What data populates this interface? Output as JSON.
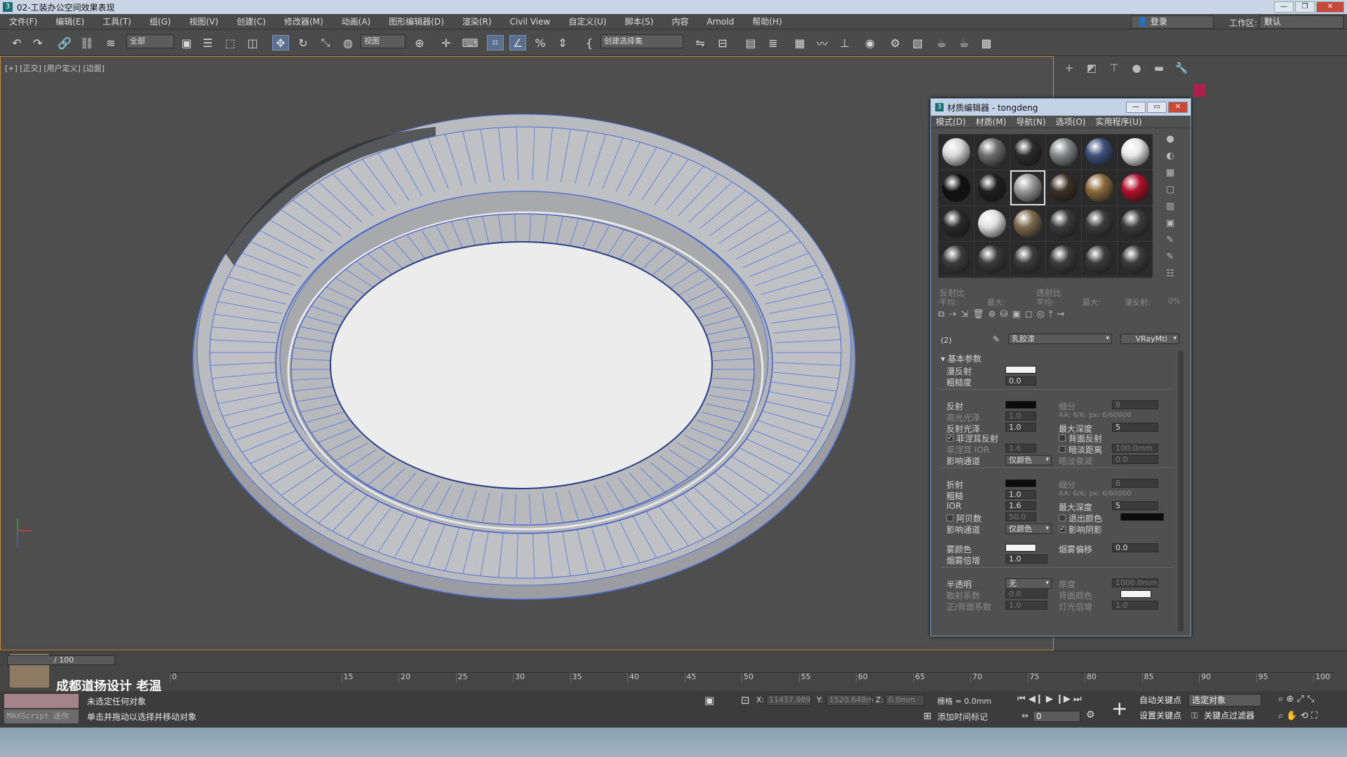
{
  "window": {
    "title": "02-工装办公空间效果表现"
  },
  "menu": [
    "文件(F)",
    "编辑(E)",
    "工具(T)",
    "组(G)",
    "视图(V)",
    "创建(C)",
    "修改器(M)",
    "动画(A)",
    "图形编辑器(D)",
    "渲染(R)",
    "Civil View",
    "自定义(U)",
    "脚本(S)",
    "内容",
    "Arnold",
    "帮助(H)"
  ],
  "account": {
    "login": "登录",
    "workspace_label": "工作区:",
    "workspace_value": "默认"
  },
  "toolbar": {
    "filter": "全部",
    "ref_coord": "视图",
    "selection_set": "创建选择集"
  },
  "viewport": {
    "label": "[+] [正交] [用户定义] [边面]"
  },
  "material_editor": {
    "title": "材质编辑器 - tongdeng",
    "menu": [
      "模式(D)",
      "材质(M)",
      "导航(N)",
      "选项(O)",
      "实用程序(U)"
    ],
    "slot_colors": [
      [
        "#d8d8d8",
        "#6e6e6e",
        "#2a2a2a",
        "#7f8a88",
        "#3c4f7a",
        "#e8e8e8"
      ],
      [
        "#111111",
        "#1e1e1e",
        "#9a9a9a",
        "#3b3026",
        "#8a6a3c",
        "#b0102a"
      ],
      [
        "#2a2a2a",
        "#e0e0e0",
        "#7d6a4e",
        "#3c3c3c",
        "#3c3c3c",
        "#3c3c3c"
      ],
      [
        "#3c3c3c",
        "#3c3c3c",
        "#3c3c3c",
        "#3c3c3c",
        "#3c3c3c",
        "#3c3c3c"
      ]
    ],
    "stats": {
      "reflect": "反射比",
      "trans": "透射比",
      "avg1": "平均:",
      "max1": "最大:",
      "avg2": "平均:",
      "max2": "最大:",
      "diffuse": "漫反射:",
      "pct": "0%"
    },
    "material_name": "乳胶漆",
    "material_type": "VRayMtl",
    "slot_index": "(2)",
    "rollout": "基本参数",
    "params": {
      "diffuse": "漫反射",
      "roughness": "粗糙度",
      "roughness_val": "0.0",
      "reflect": "反射",
      "subdiv": "细分",
      "subdiv_val": "8",
      "hilight": "高光光泽",
      "hilight_val": "1.0",
      "aa_note": "AA: 6/6; px: 6/60000",
      "refl_gloss": "反射光泽",
      "refl_gloss_val": "1.0",
      "max_depth": "最大深度",
      "max_depth_val": "5",
      "fresnel": "菲涅耳反射",
      "back_reflect": "背面反射",
      "fresnel_ior": "菲涅耳 IOR",
      "fresnel_ior_val": "1.6",
      "dim_dist": "暗淡距离",
      "dim_dist_val": "100.0mm",
      "affect_ch": "影响通道",
      "affect_val": "仅颜色",
      "dim_falloff": "暗淡衰减",
      "dim_falloff_val": "0.0",
      "refract": "折射",
      "refr_subdiv": "细分",
      "refr_subdiv_val": "8",
      "gloss": "粗糙",
      "gloss_val": "1.0",
      "refr_aa": "AA: 6/6; px: 6/60000",
      "ior": "IOR",
      "ior_val": "1.6",
      "refr_max_depth": "最大深度",
      "refr_max_depth_val": "5",
      "abbe": "阿贝数",
      "abbe_val": "50.0",
      "exit_color": "退出颜色",
      "refr_affect": "影响通道",
      "refr_affect_val": "仅颜色",
      "affect_shadow": "影响阴影",
      "fog_color": "雾颜色",
      "fog_bias": "烟雾偏移",
      "fog_bias_val": "0.0",
      "fog_mult": "烟雾倍增",
      "fog_mult_val": "1.0",
      "translucency": "半透明",
      "transl_val": "无",
      "thickness": "厚度",
      "thickness_val": "1000.0mm",
      "scatter": "散射系数",
      "scatter_val": "0.0",
      "back_color": "背面颜色",
      "fb_coef": "正/背面系数",
      "fb_coef_val": "1.0",
      "light_mult": "灯光倍增",
      "light_mult_val": "1.0"
    }
  },
  "timeline": {
    "frame": "/ 100",
    "ticks": [
      "0",
      "15",
      "20",
      "25",
      "30",
      "35",
      "40",
      "45",
      "50",
      "55",
      "60",
      "65",
      "70",
      "75",
      "80",
      "85",
      "90",
      "95",
      "100"
    ]
  },
  "brand": "成都道扬设计  老温",
  "status": {
    "maxscript": "MAXScript 迷你",
    "line1": "未选定任何对象",
    "line2": "单击并拖动以选择并移动对象",
    "x_label": "X:",
    "x_val": "11437.989",
    "y_label": "Y:",
    "y_val": "1520.648m",
    "z_label": "Z:",
    "z_val": "0.0mm",
    "grid": "栅格 = 0.0mm",
    "add_time_tag": "添加时间标记",
    "auto_key": "自动关键点",
    "set_key": "设置关键点",
    "selected": "选定对象",
    "key_filter": "关键点过滤器",
    "frame_val": "0"
  }
}
